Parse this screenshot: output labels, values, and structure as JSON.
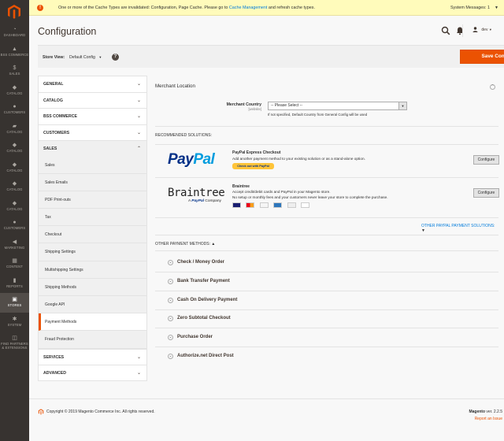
{
  "sidebar": {
    "items": [
      {
        "label": "Dashboard",
        "icon": "dashboard-icon"
      },
      {
        "label": "BSS Commerce",
        "icon": "bss-icon"
      },
      {
        "label": "Sales",
        "icon": "dollar-icon"
      },
      {
        "label": "Catalog",
        "icon": "cube-icon"
      },
      {
        "label": "Customers",
        "icon": "person-icon"
      },
      {
        "label": "Catalog",
        "icon": "cart-icon"
      },
      {
        "label": "Catalog",
        "icon": "cube-icon"
      },
      {
        "label": "Catalog",
        "icon": "cube-icon"
      },
      {
        "label": "Catalog",
        "icon": "cube-icon"
      },
      {
        "label": "Catalog",
        "icon": "cube-icon"
      },
      {
        "label": "Customers",
        "icon": "person-icon"
      },
      {
        "label": "Marketing",
        "icon": "megaphone-icon"
      },
      {
        "label": "Content",
        "icon": "content-icon"
      },
      {
        "label": "Reports",
        "icon": "chart-icon"
      },
      {
        "label": "Stores",
        "icon": "store-icon"
      },
      {
        "label": "System",
        "icon": "gear-icon"
      },
      {
        "label": "Find Partners & Extensions",
        "icon": "extensions-icon"
      }
    ],
    "active_label": "Stores"
  },
  "notice": {
    "text": "One or more of the Cache Types are invalidated: Configuration, Page Cache. Please go to",
    "link": "Cache Management",
    "text_after": "and refresh cache types.",
    "system_messages": "System Messages: 1"
  },
  "header": {
    "title": "Configuration",
    "user": "dev"
  },
  "store_bar": {
    "label": "Store View:",
    "value": "Default Config",
    "save_label": "Save Config"
  },
  "config_nav": {
    "sections": [
      "General",
      "Catalog",
      "BSS Commerce",
      "Customers",
      "Sales",
      "Services",
      "Advanced"
    ],
    "sales_items": [
      "Sales",
      "Sales Emails",
      "PDF Print-outs",
      "Tax",
      "Checkout",
      "Shipping Settings",
      "Multishipping Settings",
      "Shipping Methods",
      "Google API",
      "Payment Methods",
      "Fraud Protection"
    ],
    "selected": "Payment Methods"
  },
  "main": {
    "merchant_location": "Merchant Location",
    "merchant_country_label": "Merchant Country",
    "merchant_country_scope": "[website]",
    "merchant_country_value": "-- Please Select --",
    "merchant_country_note": "If not specified, Default Country from General Config will be used",
    "recommended_label": "Recommended Solutions:",
    "paypal": {
      "logo_a": "Pay",
      "logo_b": "Pal",
      "title": "PayPal Express Checkout",
      "desc": "Add another payment method to your existing solution or as a stand-alone option.",
      "badge": "Check out with PayPal",
      "configure": "Configure"
    },
    "braintree": {
      "logo": "Braintree",
      "sub_prefix": "A",
      "sub_brand": "PayPal",
      "sub_suffix": "Company",
      "title": "Braintree",
      "desc1": "Accept credit/debit cards and PayPal in your Magento store.",
      "desc2": "No setup or monthly fees and your customers never leave your store to complete the purchase.",
      "configure": "Configure"
    },
    "other_paypal_link": "Other PayPal Payment Solutions:",
    "other_methods_label": "Other Payment Methods:",
    "methods": [
      "Check / Money Order",
      "Bank Transfer Payment",
      "Cash On Delivery Payment",
      "Zero Subtotal Checkout",
      "Purchase Order",
      "Authorize.net Direct Post"
    ]
  },
  "footer": {
    "copyright": "Copyright © 2019 Magento Commerce Inc. All rights reserved.",
    "version_brand": "Magento",
    "version": "ver. 2.2.5",
    "report": "Report an Issue"
  },
  "colors": {
    "accent": "#eb5202",
    "sidebar_bg": "#373330",
    "link": "#007bdb"
  }
}
